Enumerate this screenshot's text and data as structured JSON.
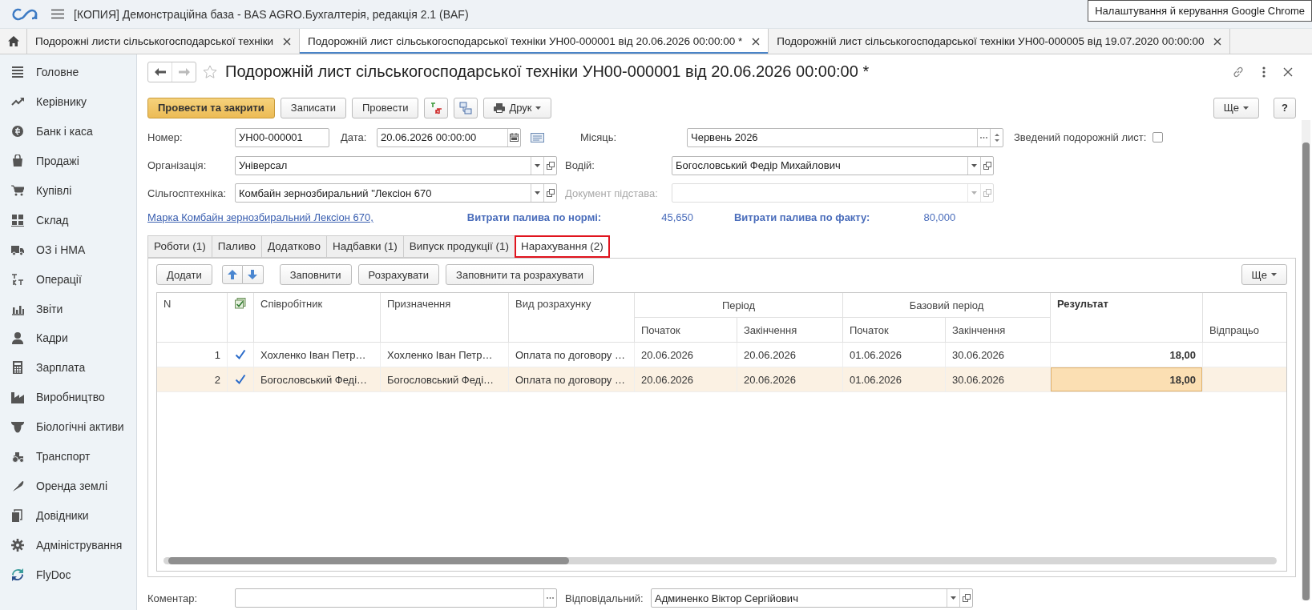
{
  "app": {
    "title": "[КОПИЯ] Демонстраційна база - BAS AGRO.Бухгалтерія, редакція 2.1  (BAF)",
    "tooltip": "Налаштування й керування Google Chrome"
  },
  "open_tabs": [
    {
      "label": "Подорожні листи сільськогосподарської техніки",
      "selected": false
    },
    {
      "label": "Подорожній лист сільськогосподарської техніки УН00-000001 від 20.06.2026 00:00:00 *",
      "selected": true
    },
    {
      "label": "Подорожній лист сільськогосподарської техніки УН00-000005 від 19.07.2020 00:00:00",
      "selected": false
    }
  ],
  "sidebar": {
    "items": [
      {
        "label": "Головне"
      },
      {
        "label": "Керівнику"
      },
      {
        "label": "Банк і каса"
      },
      {
        "label": "Продажі"
      },
      {
        "label": "Купівлі"
      },
      {
        "label": "Склад"
      },
      {
        "label": "ОЗ і НМА"
      },
      {
        "label": "Операції"
      },
      {
        "label": "Звіти"
      },
      {
        "label": "Кадри"
      },
      {
        "label": "Зарплата"
      },
      {
        "label": "Виробництво"
      },
      {
        "label": "Біологічні активи"
      },
      {
        "label": "Транспорт"
      },
      {
        "label": "Оренда землі"
      },
      {
        "label": "Довідники"
      },
      {
        "label": "Адміністрування"
      },
      {
        "label": "FlyDoc"
      }
    ]
  },
  "document": {
    "title": "Подорожній лист сільськогосподарської техніки УН00-000001 від 20.06.2026 00:00:00 *",
    "buttons": [
      {
        "kind": "primary",
        "label": "Провести та закрити"
      },
      {
        "kind": "plain",
        "label": "Записати"
      },
      {
        "kind": "plain",
        "label": "Провести"
      },
      {
        "kind": "icon"
      },
      {
        "kind": "icon"
      },
      {
        "kind": "menu",
        "label": "Друк"
      }
    ],
    "more_button": "Ще",
    "help_button": "?",
    "number": {
      "label": "Номер:",
      "value": "УН00-000001"
    },
    "date": {
      "label": "Дата:",
      "value": "20.06.2026 00:00:00"
    },
    "month": {
      "label": "Місяць:",
      "value": "Червень 2026"
    },
    "summary": {
      "label": "Зведений подорожній лист:",
      "checked": false
    },
    "organization": {
      "label": "Організація:",
      "value": "Універсал"
    },
    "driver": {
      "label": "Водій:",
      "value": "Богословський Федір Михайлович"
    },
    "machine": {
      "label": "Сільгосптехніка:",
      "value": "Комбайн зернозбиральний \"Лексіон 670"
    },
    "basis_document": {
      "label": "Документ підстава:",
      "disabled": true
    },
    "brand_link": "Марка Комбайн зернозбиральний Лексіон 670,",
    "fuel_norm": {
      "label": "Витрати палива по нормі:",
      "value": "45,650"
    },
    "fuel_fact": {
      "label": "Витрати палива по факту:",
      "value": "80,000"
    },
    "tabs": [
      {
        "label": "Роботи (1)",
        "selected": false
      },
      {
        "label": "Паливо",
        "selected": false
      },
      {
        "label": "Додатково",
        "selected": false
      },
      {
        "label": "Надбавки (1)",
        "selected": false
      },
      {
        "label": "Випуск продукції (1)",
        "selected": false
      },
      {
        "label": "Нарахування (2)",
        "selected": true
      }
    ],
    "table_toolbar": {
      "add": "Додати",
      "fill": "Заповнити",
      "calculate": "Розрахувати",
      "fill_calculate": "Заповнити та розрахувати",
      "more": "Ще"
    },
    "table": {
      "column_groups": [
        "Період",
        "Базовий період"
      ],
      "columns": [
        {
          "kind": "single",
          "label": "N"
        },
        {
          "kind": "single",
          "label": "Співробітник"
        },
        {
          "kind": "single",
          "label": "Призначення"
        },
        {
          "kind": "single",
          "label": "Вид розрахунку"
        },
        {
          "kind": "group_first",
          "label": "Початок"
        },
        {
          "kind": "group_next",
          "label": "Закінчення"
        },
        {
          "kind": "group_first",
          "label": "Початок"
        },
        {
          "kind": "group_next",
          "label": "Закінчення"
        },
        {
          "kind": "result",
          "label": "Результат"
        },
        {
          "kind": "lower",
          "label": "Відпрацьо"
        }
      ],
      "rows": [
        {
          "checked": true,
          "selected": false,
          "cells": [
            "1",
            "Хохленко Іван Петр…",
            "Хохленко Іван Петр…",
            "Оплата по договору …",
            "20.06.2026",
            "20.06.2026",
            "01.06.2026",
            "30.06.2026",
            "18,00"
          ]
        },
        {
          "checked": true,
          "selected": true,
          "cells": [
            "2",
            "Богословський Феді…",
            "Богословський Феді…",
            "Оплата по договору …",
            "20.06.2026",
            "20.06.2026",
            "01.06.2026",
            "30.06.2026",
            "18,00"
          ]
        }
      ]
    },
    "comment": {
      "label": "Коментар:"
    },
    "responsible": {
      "label": "Відповідальний:",
      "value": "Админенко Віктор Сергійович"
    }
  }
}
